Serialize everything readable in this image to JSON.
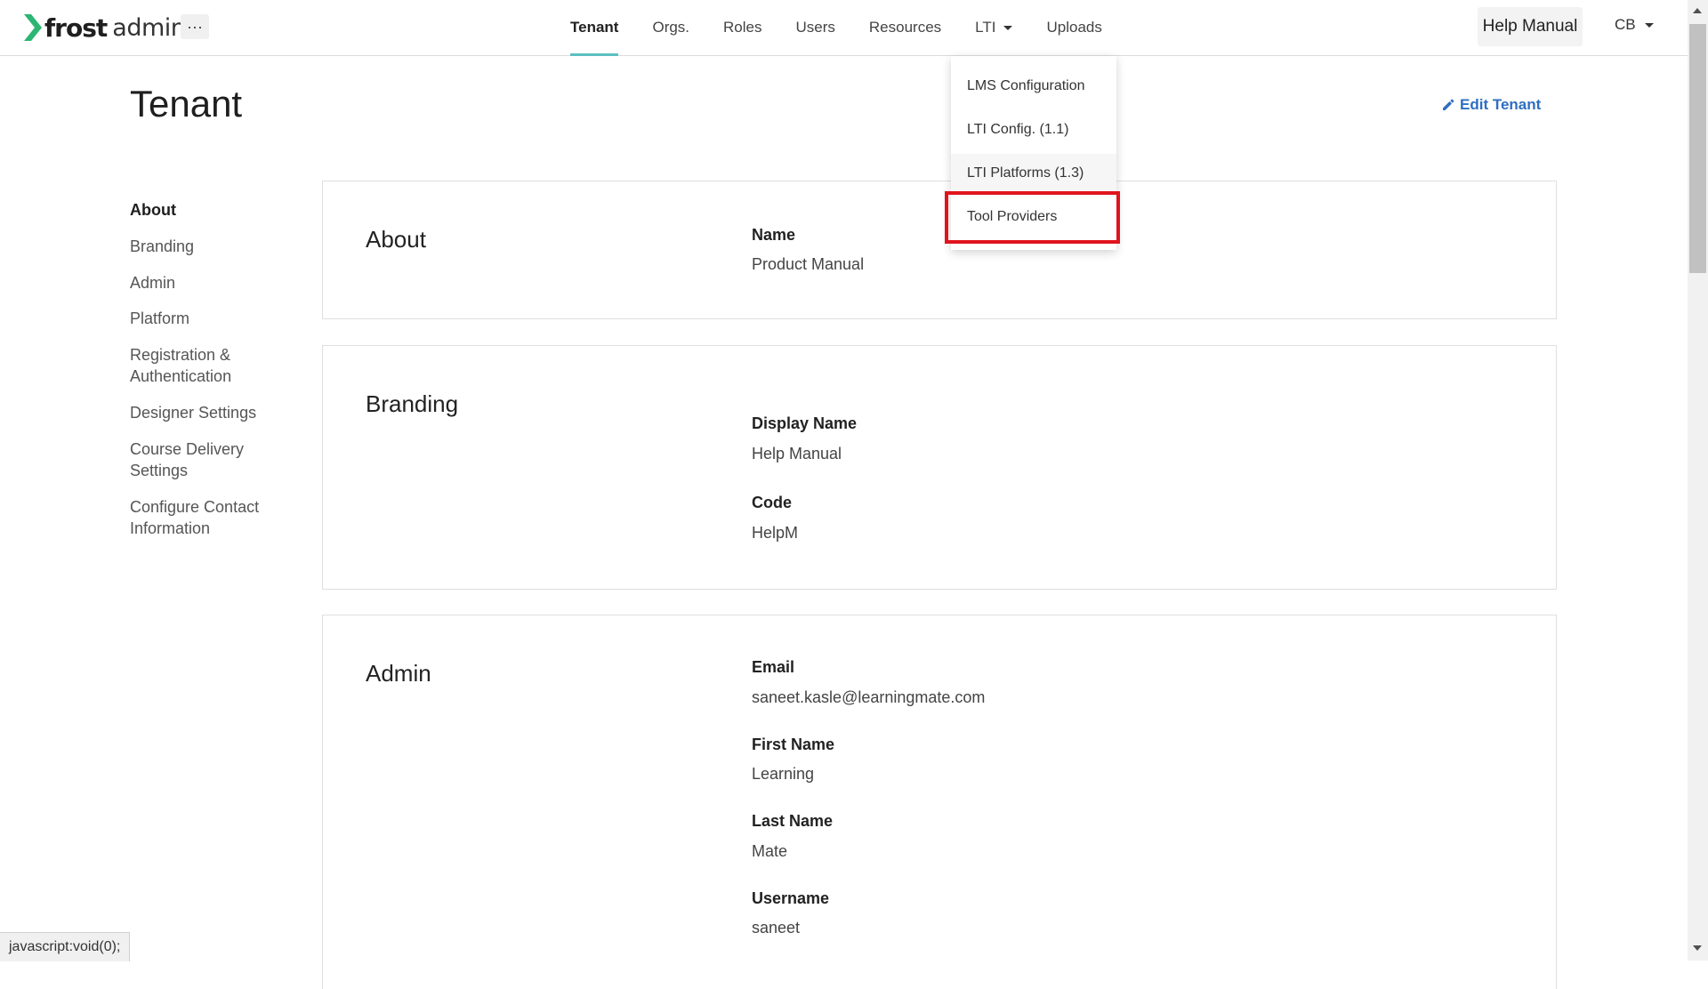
{
  "brand": {
    "name_bold": "frost",
    "name_light": "admin",
    "accent": "#2bb673"
  },
  "header": {
    "more_label": "···",
    "nav": [
      {
        "label": "Tenant",
        "active": true
      },
      {
        "label": "Orgs."
      },
      {
        "label": "Roles"
      },
      {
        "label": "Users"
      },
      {
        "label": "Resources"
      },
      {
        "label": "LTI",
        "dropdown": true
      },
      {
        "label": "Uploads"
      }
    ],
    "help_label": "Help Manual",
    "user_initials": "CB"
  },
  "lti_menu": {
    "items": [
      "LMS Configuration",
      "LTI Config. (1.1)",
      "LTI Platforms (1.3)",
      "Tool Providers"
    ],
    "highlighted": "Tool Providers",
    "highlight_color": "#e0141d"
  },
  "page": {
    "title": "Tenant",
    "edit_label": "Edit Tenant",
    "edit_icon": "pencil-icon",
    "link_color": "#2e6ec2"
  },
  "side_nav": [
    {
      "label": "About",
      "active": true
    },
    {
      "label": "Branding"
    },
    {
      "label": "Admin"
    },
    {
      "label": "Platform"
    },
    {
      "label": "Registration & Authentication",
      "lines": [
        "Registration &",
        "Authentication"
      ]
    },
    {
      "label": "Designer Settings"
    },
    {
      "label": "Course Delivery Settings",
      "lines": [
        "Course Delivery",
        "Settings"
      ]
    },
    {
      "label": "Configure Contact Information",
      "lines": [
        "Configure Contact",
        "Information"
      ]
    }
  ],
  "sections": {
    "about": {
      "title": "About",
      "fields": [
        {
          "label": "Name",
          "value": "Product Manual"
        }
      ]
    },
    "branding": {
      "title": "Branding",
      "fields": [
        {
          "label": "Display Name",
          "value": "Help Manual"
        },
        {
          "label": "Code",
          "value": "HelpM"
        }
      ]
    },
    "admin": {
      "title": "Admin",
      "fields": [
        {
          "label": "Email",
          "value": "saneet.kasle@learningmate.com"
        },
        {
          "label": "First Name",
          "value": "Learning"
        },
        {
          "label": "Last Name",
          "value": "Mate"
        },
        {
          "label": "Username",
          "value": "saneet"
        }
      ]
    }
  },
  "status_bar": "javascript:void(0);"
}
